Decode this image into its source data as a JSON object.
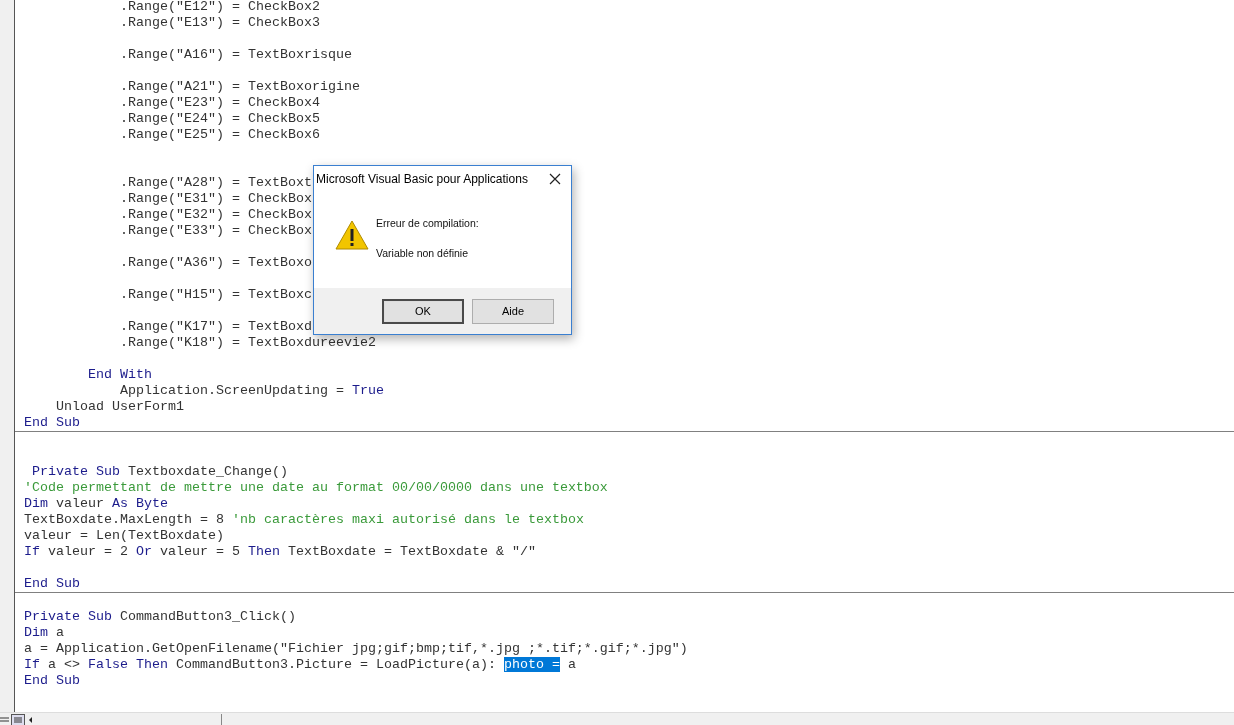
{
  "editor": {
    "sections": [
      {
        "lines": [
          {
            "kind": "code",
            "segments": [
              {
                "text": "            .Range(\"E12\") = CheckBox2",
                "kind": "plain"
              }
            ]
          },
          {
            "kind": "code",
            "segments": [
              {
                "text": "            .Range(\"E13\") = CheckBox3",
                "kind": "plain"
              }
            ]
          },
          {
            "kind": "blank"
          },
          {
            "kind": "code",
            "segments": [
              {
                "text": "            .Range(\"A16\") = TextBoxrisque",
                "kind": "plain"
              }
            ]
          },
          {
            "kind": "blank"
          },
          {
            "kind": "code",
            "segments": [
              {
                "text": "            .Range(\"A21\") = TextBoxorigine",
                "kind": "plain"
              }
            ]
          },
          {
            "kind": "code",
            "segments": [
              {
                "text": "            .Range(\"E23\") = CheckBox4",
                "kind": "plain"
              }
            ]
          },
          {
            "kind": "code",
            "segments": [
              {
                "text": "            .Range(\"E24\") = CheckBox5",
                "kind": "plain"
              }
            ]
          },
          {
            "kind": "code",
            "segments": [
              {
                "text": "            .Range(\"E25\") = CheckBox6",
                "kind": "plain"
              }
            ]
          },
          {
            "kind": "blank"
          },
          {
            "kind": "blank"
          },
          {
            "kind": "code",
            "segments": [
              {
                "text": "            .Range(\"A28\") = TextBoxt",
                "kind": "plain"
              }
            ]
          },
          {
            "kind": "code",
            "segments": [
              {
                "text": "            .Range(\"E31\") = CheckBox",
                "kind": "plain"
              }
            ]
          },
          {
            "kind": "code",
            "segments": [
              {
                "text": "            .Range(\"E32\") = CheckBox",
                "kind": "plain"
              }
            ]
          },
          {
            "kind": "code",
            "segments": [
              {
                "text": "            .Range(\"E33\") = CheckBox",
                "kind": "plain"
              }
            ]
          },
          {
            "kind": "blank"
          },
          {
            "kind": "code",
            "segments": [
              {
                "text": "            .Range(\"A36\") = TextBoxo",
                "kind": "plain"
              }
            ]
          },
          {
            "kind": "blank"
          },
          {
            "kind": "code",
            "segments": [
              {
                "text": "            .Range(\"H15\") = TextBoxc",
                "kind": "plain"
              }
            ]
          },
          {
            "kind": "blank"
          },
          {
            "kind": "code",
            "segments": [
              {
                "text": "            .Range(\"K17\") = TextBoxd",
                "kind": "plain"
              }
            ]
          },
          {
            "kind": "code",
            "segments": [
              {
                "text": "            .Range(\"K18\") = TextBoxdureevie2",
                "kind": "plain"
              }
            ]
          },
          {
            "kind": "blank"
          },
          {
            "kind": "code",
            "segments": [
              {
                "text": "        End With",
                "kind": "keyword"
              }
            ]
          },
          {
            "kind": "code",
            "segments": [
              {
                "text": "            Application.ScreenUpdating = ",
                "kind": "plain"
              },
              {
                "text": "True",
                "kind": "keyword"
              }
            ]
          },
          {
            "kind": "code",
            "segments": [
              {
                "text": "    Unload UserForm1",
                "kind": "plain"
              }
            ]
          },
          {
            "kind": "code",
            "segments": [
              {
                "text": "End Sub",
                "kind": "keyword"
              }
            ]
          }
        ]
      },
      {
        "lines": [
          {
            "kind": "blank"
          },
          {
            "kind": "blank"
          },
          {
            "kind": "code",
            "segments": [
              {
                "text": " Private Sub",
                "kind": "keyword"
              },
              {
                "text": " Textboxdate_Change()",
                "kind": "plain"
              }
            ]
          },
          {
            "kind": "code",
            "segments": [
              {
                "text": "'Code permettant de mettre une date au format 00/00/0000 dans une textbox",
                "kind": "comment"
              }
            ]
          },
          {
            "kind": "code",
            "segments": [
              {
                "text": "Dim",
                "kind": "keyword"
              },
              {
                "text": " valeur ",
                "kind": "plain"
              },
              {
                "text": "As Byte",
                "kind": "keyword"
              }
            ]
          },
          {
            "kind": "code",
            "segments": [
              {
                "text": "TextBoxdate.MaxLength = 8 ",
                "kind": "plain"
              },
              {
                "text": "'nb caractères maxi autorisé dans le textbox",
                "kind": "comment"
              }
            ]
          },
          {
            "kind": "code",
            "segments": [
              {
                "text": "valeur = Len(TextBoxdate)",
                "kind": "plain"
              }
            ]
          },
          {
            "kind": "code",
            "segments": [
              {
                "text": "If",
                "kind": "keyword"
              },
              {
                "text": " valeur = 2 ",
                "kind": "plain"
              },
              {
                "text": "Or",
                "kind": "keyword"
              },
              {
                "text": " valeur = 5 ",
                "kind": "plain"
              },
              {
                "text": "Then",
                "kind": "keyword"
              },
              {
                "text": " TextBoxdate = TextBoxdate & \"/\"",
                "kind": "plain"
              }
            ]
          },
          {
            "kind": "blank"
          },
          {
            "kind": "code",
            "segments": [
              {
                "text": "End Sub",
                "kind": "keyword"
              }
            ]
          }
        ]
      },
      {
        "lines": [
          {
            "kind": "blank"
          },
          {
            "kind": "code",
            "segments": [
              {
                "text": "Private Sub",
                "kind": "keyword"
              },
              {
                "text": " CommandButton3_Click()",
                "kind": "plain"
              }
            ]
          },
          {
            "kind": "code",
            "segments": [
              {
                "text": "Dim",
                "kind": "keyword"
              },
              {
                "text": " a",
                "kind": "plain"
              }
            ]
          },
          {
            "kind": "code",
            "segments": [
              {
                "text": "a = Application.GetOpenFilename(\"Fichier jpg;gif;bmp;tif,*.jpg ;*.tif;*.gif;*.jpg\")",
                "kind": "plain"
              }
            ]
          },
          {
            "kind": "code",
            "segments": [
              {
                "text": "If",
                "kind": "keyword"
              },
              {
                "text": " a <> ",
                "kind": "plain"
              },
              {
                "text": "False Then",
                "kind": "keyword"
              },
              {
                "text": " CommandButton3.Picture = LoadPicture(a): ",
                "kind": "plain"
              },
              {
                "text": "photo =",
                "kind": "selected"
              },
              {
                "text": " a",
                "kind": "plain"
              }
            ]
          },
          {
            "kind": "code",
            "segments": [
              {
                "text": "End Sub",
                "kind": "keyword"
              }
            ]
          }
        ]
      }
    ]
  },
  "dialog": {
    "title": "Microsoft Visual Basic pour Applications",
    "heading": "Erreur de compilation:",
    "message": "Variable non définie",
    "buttons": [
      {
        "label": "OK",
        "default": true
      },
      {
        "label": "Aide",
        "default": false
      }
    ]
  }
}
